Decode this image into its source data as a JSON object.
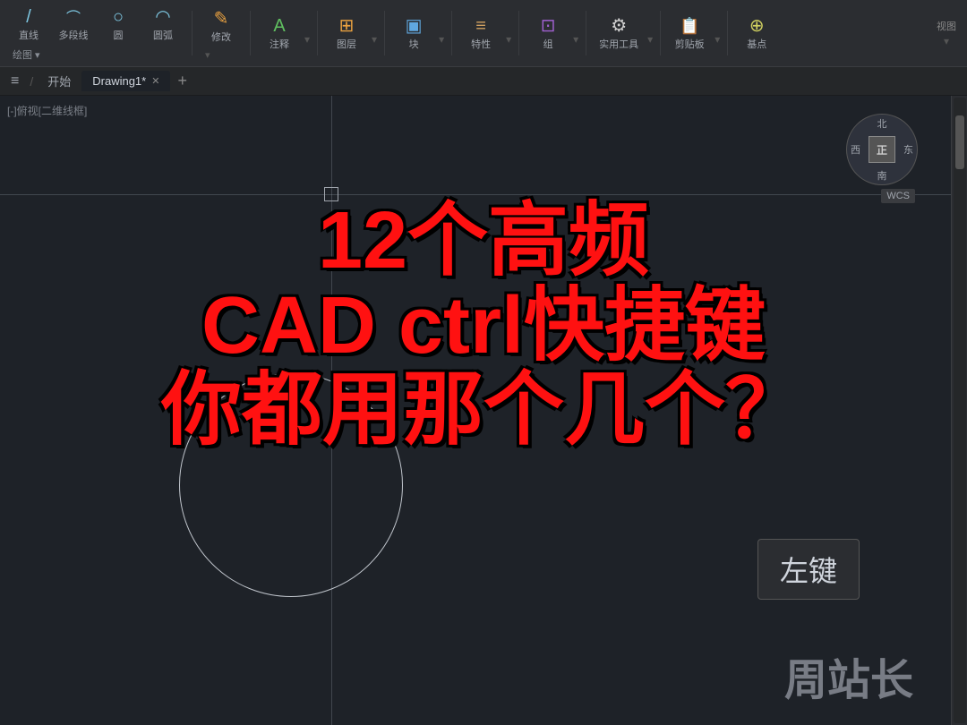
{
  "toolbar": {
    "groups": [
      {
        "id": "line",
        "icon": "line",
        "label": "直线"
      },
      {
        "id": "polyline",
        "icon": "polyline",
        "label": "多段线"
      },
      {
        "id": "circle",
        "icon": "circle",
        "label": "圆"
      },
      {
        "id": "arc",
        "icon": "arc",
        "label": "圆弧"
      },
      {
        "id": "modify",
        "icon": "modify",
        "label": "修改"
      },
      {
        "id": "annotate",
        "icon": "annotate",
        "label": "注释"
      },
      {
        "id": "layer",
        "icon": "layer",
        "label": "图层"
      },
      {
        "id": "block",
        "icon": "block",
        "label": "块"
      },
      {
        "id": "property",
        "icon": "property",
        "label": "特性"
      },
      {
        "id": "group",
        "icon": "group",
        "label": "组"
      },
      {
        "id": "utility",
        "icon": "utility",
        "label": "实用工具"
      },
      {
        "id": "clipboard",
        "icon": "clipboard",
        "label": "剪贴板"
      },
      {
        "id": "base",
        "icon": "base",
        "label": "基点"
      }
    ],
    "draw_section": "绘图",
    "view_section": "视图"
  },
  "tabbar": {
    "menu_icon": "≡",
    "separator": "/",
    "home_label": "开始",
    "active_tab": "Drawing1*",
    "add_tab": "+"
  },
  "canvas": {
    "view_label": "[-]俯视[二维线框]",
    "compass": {
      "north": "北",
      "south": "南",
      "east": "东",
      "west": "西",
      "center": "正"
    },
    "wcs_label": "WCS"
  },
  "overlay": {
    "line1": "12个高频",
    "line2": "CAD ctrl快捷键",
    "line3": "你都用那个几个？"
  },
  "badge": {
    "left_key": "左键"
  },
  "watermark": {
    "text": "周站长"
  }
}
